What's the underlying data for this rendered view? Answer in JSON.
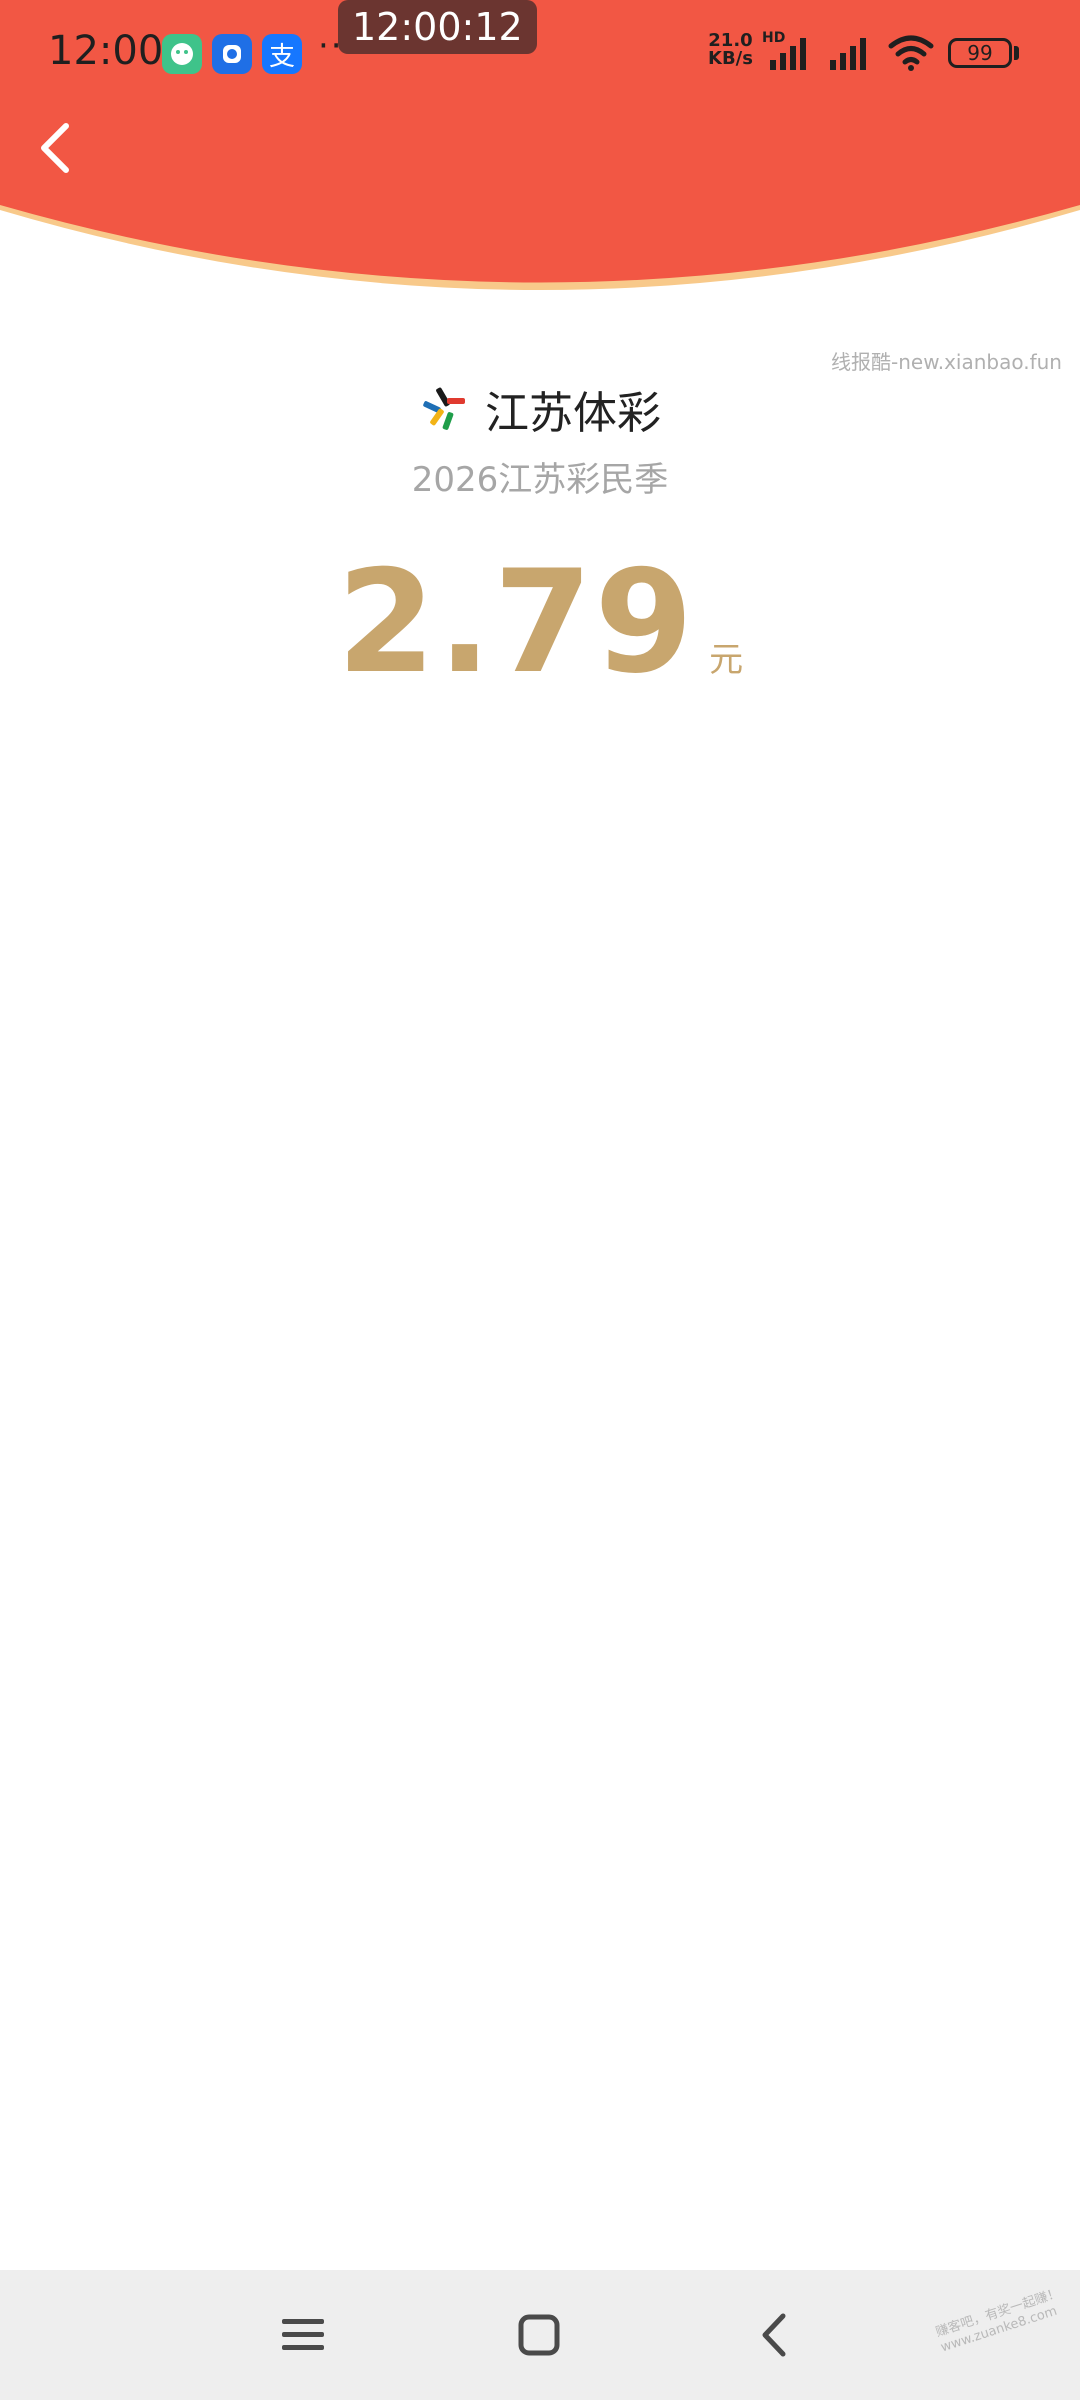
{
  "status_bar": {
    "time": "12:00",
    "screen_clock": "12:00:12",
    "more": "···",
    "net_speed_value": "21.0",
    "net_speed_unit": "KB/s",
    "hd": "HD",
    "battery": "99",
    "app_icons": [
      "app-icon",
      "app-icon",
      "alipay-icon"
    ],
    "alipay_glyph": "支"
  },
  "header": {
    "color": "#f25744",
    "back_icon": "chevron-left-icon"
  },
  "watermark_top": "线报酷-new.xianbao.fun",
  "brand": {
    "name": "江苏体彩",
    "subtitle": "2026江苏彩民季"
  },
  "amount": {
    "value": "2.79",
    "unit": "元",
    "color": "#c8a66e"
  },
  "nav_bar": {
    "icons": [
      "menu-icon",
      "home-icon",
      "back-icon"
    ]
  },
  "watermark_bottom": {
    "line1": "赚客吧，有奖一起赚！",
    "line2": "www.zuanke8.com"
  }
}
